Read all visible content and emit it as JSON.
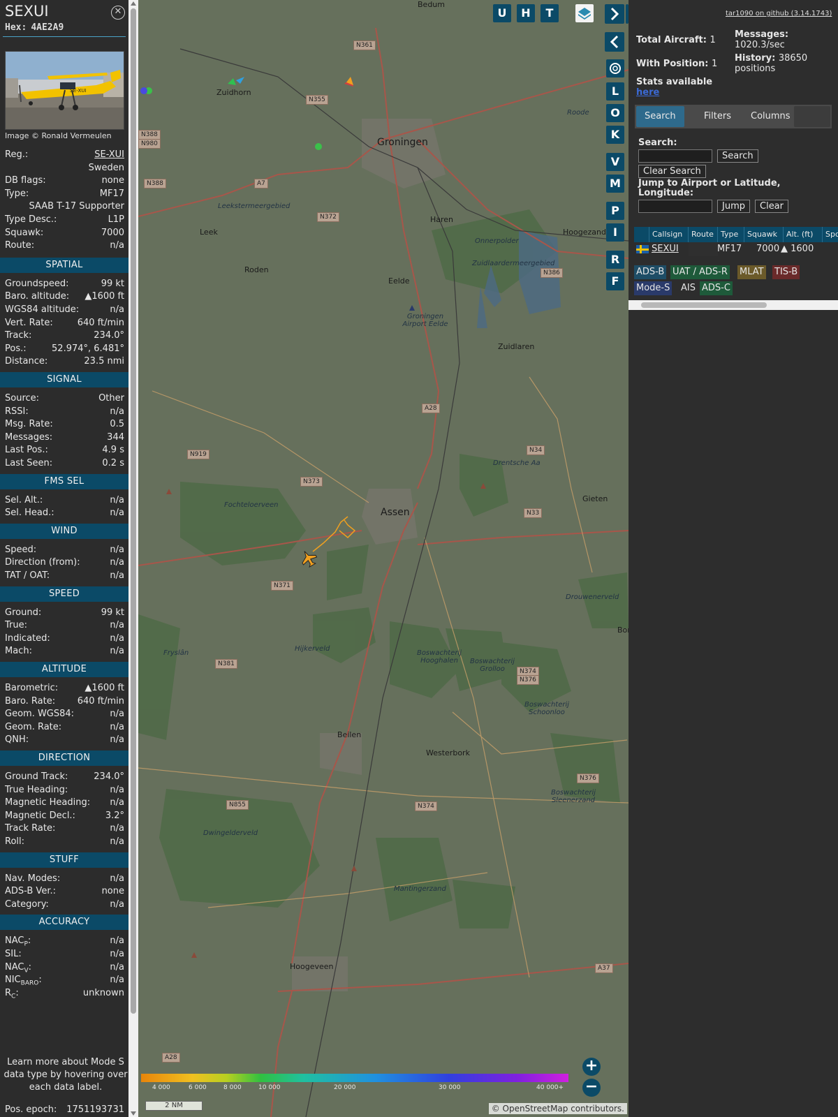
{
  "info": {
    "callsign": "SEXUI",
    "hex_label": "Hex:",
    "hex": "4AE2A9",
    "photo_credit": "Image © Ronald Vermeulen",
    "basic": [
      {
        "k": "Reg.:",
        "v": "SE-XUI",
        "link": true
      },
      {
        "k": "",
        "v": "Sweden"
      },
      {
        "k": "DB flags:",
        "v": "none"
      },
      {
        "k": "Type:",
        "v": "MF17"
      },
      {
        "k": "",
        "v": "SAAB T-17 Supporter"
      },
      {
        "k": "Type Desc.:",
        "v": "L1P"
      },
      {
        "k": "Squawk:",
        "v": "7000"
      },
      {
        "k": "Route:",
        "v": "n/a"
      }
    ],
    "sections": [
      {
        "title": "SPATIAL",
        "rows": [
          {
            "k": "Groundspeed:",
            "v": "99 kt"
          },
          {
            "k": "Baro. altitude:",
            "v": "▲1600 ft"
          },
          {
            "k": "WGS84 altitude:",
            "v": "n/a"
          },
          {
            "k": "Vert. Rate:",
            "v": "640 ft/min"
          },
          {
            "k": "Track:",
            "v": "234.0°"
          },
          {
            "k": "Pos.:",
            "v": "52.974°, 6.481°"
          },
          {
            "k": "Distance:",
            "v": "23.5 nmi"
          }
        ]
      },
      {
        "title": "SIGNAL",
        "rows": [
          {
            "k": "Source:",
            "v": "Other"
          },
          {
            "k": "RSSI:",
            "v": "n/a"
          },
          {
            "k": "Msg. Rate:",
            "v": "0.5"
          },
          {
            "k": "Messages:",
            "v": "344"
          },
          {
            "k": "Last Pos.:",
            "v": "4.9 s"
          },
          {
            "k": "Last Seen:",
            "v": "0.2 s"
          }
        ]
      },
      {
        "title": "FMS SEL",
        "rows": [
          {
            "k": "Sel. Alt.:",
            "v": "n/a"
          },
          {
            "k": "Sel. Head.:",
            "v": "n/a"
          }
        ]
      },
      {
        "title": "WIND",
        "rows": [
          {
            "k": "Speed:",
            "v": "n/a"
          },
          {
            "k": "Direction (from):",
            "v": "n/a"
          },
          {
            "k": "TAT / OAT:",
            "v": "n/a"
          }
        ]
      },
      {
        "title": "SPEED",
        "rows": [
          {
            "k": "Ground:",
            "v": "99 kt"
          },
          {
            "k": "True:",
            "v": "n/a"
          },
          {
            "k": "Indicated:",
            "v": "n/a"
          },
          {
            "k": "Mach:",
            "v": "n/a"
          }
        ]
      },
      {
        "title": "ALTITUDE",
        "rows": [
          {
            "k": "Barometric:",
            "v": "▲1600 ft"
          },
          {
            "k": "Baro. Rate:",
            "v": "640 ft/min"
          },
          {
            "k": "Geom. WGS84:",
            "v": "n/a"
          },
          {
            "k": "Geom. Rate:",
            "v": "n/a"
          },
          {
            "k": "QNH:",
            "v": "n/a"
          }
        ]
      },
      {
        "title": "DIRECTION",
        "rows": [
          {
            "k": "Ground Track:",
            "v": "234.0°"
          },
          {
            "k": "True Heading:",
            "v": "n/a"
          },
          {
            "k": "Magnetic Heading:",
            "v": "n/a"
          },
          {
            "k": "Magnetic Decl.:",
            "v": "3.2°"
          },
          {
            "k": "Track Rate:",
            "v": "n/a"
          },
          {
            "k": "Roll:",
            "v": "n/a"
          }
        ]
      },
      {
        "title": "STUFF",
        "rows": [
          {
            "k": "Nav. Modes:",
            "v": "n/a"
          },
          {
            "k": "ADS-B Ver.:",
            "v": "none"
          },
          {
            "k": "Category:",
            "v": "n/a"
          }
        ]
      },
      {
        "title": "ACCURACY",
        "rows": [
          {
            "k": "NAC",
            "sub": "P",
            "k2": ":",
            "v": "n/a"
          },
          {
            "k": "SIL:",
            "v": "n/a"
          },
          {
            "k": "NAC",
            "sub": "V",
            "k2": ":",
            "v": "n/a"
          },
          {
            "k": "NIC",
            "sub": "BARO",
            "k2": ":",
            "v": "n/a"
          },
          {
            "k": "R",
            "sub": "C",
            "k2": ":",
            "v": "unknown"
          }
        ]
      }
    ],
    "learn_more": "Learn more about Mode S data type by hovering over each data label.",
    "pos_epoch_label": "Pos. epoch:",
    "pos_epoch": "1751193731"
  },
  "map": {
    "buttons_top": [
      "U",
      "H",
      "T"
    ],
    "side_buttons": [
      "L",
      "O",
      "K",
      "V",
      "M",
      "P",
      "I",
      "R",
      "F"
    ],
    "towns": [
      {
        "name": "Bedum",
        "big": false
      },
      {
        "name": "Zuidhorn",
        "big": false
      },
      {
        "name": "Groningen",
        "big": true
      },
      {
        "name": "Haren",
        "big": false
      },
      {
        "name": "Leek",
        "big": false
      },
      {
        "name": "Roden",
        "big": false
      },
      {
        "name": "Eelde",
        "big": false
      },
      {
        "name": "Hoogezand",
        "big": false
      },
      {
        "name": "Zuidlaren",
        "big": false
      },
      {
        "name": "Assen",
        "big": true
      },
      {
        "name": "Gieten",
        "big": false
      },
      {
        "name": "Beilen",
        "big": false
      },
      {
        "name": "Westerbork",
        "big": false
      },
      {
        "name": "Hoogeveen",
        "big": false
      },
      {
        "name": "Bor",
        "big": false
      }
    ],
    "areas": [
      "Leekstermeergebied",
      "Onnerpolder",
      "Zuidlaardermeergebied",
      "Groningen Airport Eelde",
      "Drentsche Aa",
      "Fochteloerveen",
      "Drouwenerveld",
      "Hijkerveld",
      "Boswachterij Hooghalen",
      "Boswachterij Grolloo",
      "Boswachterij Schoonloo",
      "Dwingelderveld",
      "Mantingerzand",
      "Boswachterij Sleenerzand",
      "Fryslân",
      "Roode"
    ],
    "road_labels": [
      "N361",
      "N355",
      "N388",
      "N980",
      "N388",
      "A7",
      "N372",
      "N386",
      "A28",
      "N919",
      "N373",
      "N34",
      "N33",
      "N371",
      "N381",
      "N374",
      "N376",
      "N855",
      "N374",
      "N376",
      "A37",
      "A28"
    ],
    "altitude_legend": [
      "4 000",
      "6 000",
      "8 000",
      "10 000",
      "20 000",
      "30 000",
      "40 000+"
    ],
    "scale": "2 NM",
    "attribution": "© OpenStreetMap contributors."
  },
  "sidebar": {
    "github_link": "tar1090 on github (3.14.1743)",
    "total_aircraft_label": "Total Aircraft:",
    "total_aircraft": "1",
    "with_position_label": "With Position:",
    "with_position": "1",
    "stats_label": "Stats available",
    "stats_link": "here",
    "messages_label": "Messages:",
    "messages": "1020.3/sec",
    "history_label": "History:",
    "history": "38650",
    "history_unit": "positions",
    "tabs": [
      "Search",
      "Filters",
      "Columns"
    ],
    "search_label": "Search:",
    "search_button": "Search",
    "clear_search_button": "Clear Search",
    "jump_label": "Jump to Airport or Latitude, Longitude:",
    "jump_button": "Jump",
    "clear_button": "Clear",
    "table": {
      "headers": [
        "Callsign",
        "Route",
        "Type",
        "Squawk",
        "Alt. (ft)",
        "Spd"
      ],
      "rows": [
        {
          "callsign": "SEXUI",
          "route": "",
          "type": "MF17",
          "squawk": "7000",
          "alt": "▲ 1600"
        }
      ]
    },
    "sources": [
      {
        "label": "ADS-B",
        "bg": "#1e4d66",
        "fg": "#e6e6e6"
      },
      {
        "label": "UAT / ADS-R",
        "bg": "#1e5a3a",
        "fg": "#e6e6e6"
      },
      {
        "label": "MLAT",
        "bg": "#6b5a2a",
        "fg": "#e6e6e6"
      },
      {
        "label": "TIS-B",
        "bg": "#6a2a2a",
        "fg": "#e6e6e6"
      },
      {
        "label": "Mode-S",
        "bg": "#2a3a6a",
        "fg": "#e6e6e6"
      },
      {
        "label": "AIS",
        "bg": "#2d2d2d",
        "fg": "#e6e6e6"
      },
      {
        "label": "ADS-C",
        "bg": "#1e5a3a",
        "fg": "#e6e6e6"
      }
    ]
  }
}
